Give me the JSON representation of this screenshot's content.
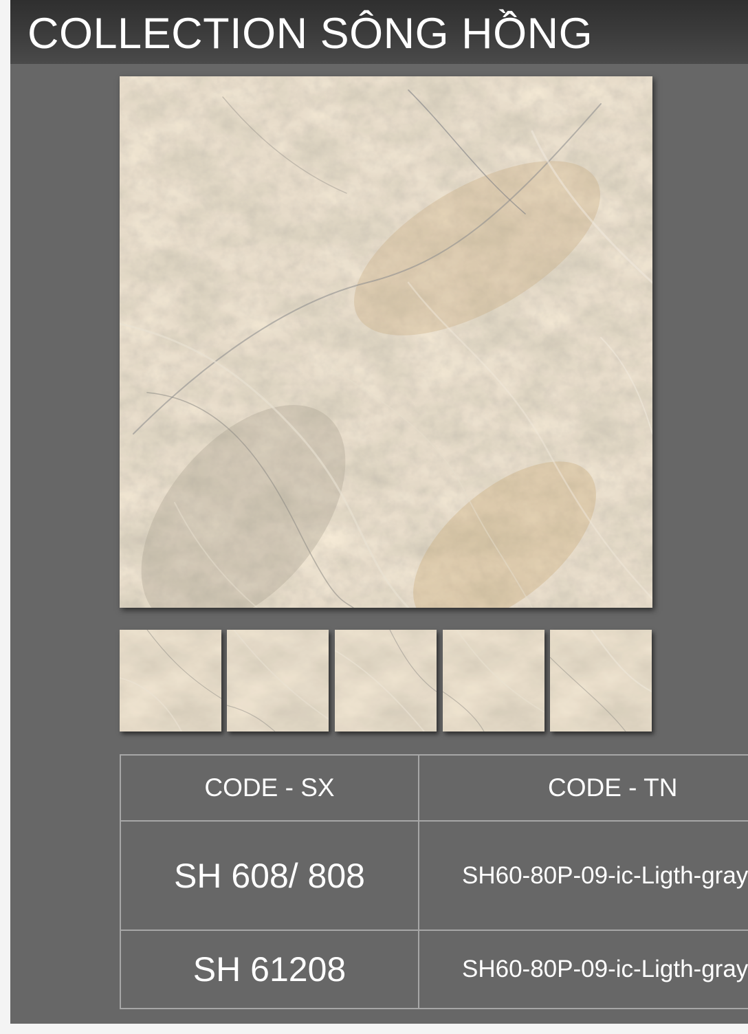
{
  "header": {
    "title": "COLLECTION SÔNG HỒNG"
  },
  "product": {
    "main_image": "marble-tile-image",
    "thumbnails": [
      "marble-tile-thumbnail",
      "marble-tile-thumbnail",
      "marble-tile-thumbnail",
      "marble-tile-thumbnail",
      "marble-tile-thumbnail"
    ]
  },
  "codes_table": {
    "headers": [
      "CODE - SX",
      "CODE - TN"
    ],
    "rows": [
      {
        "sx": "SH 608/ 808",
        "tn": "SH60-80P-09-ic-Ligth-gray"
      },
      {
        "sx": "SH 61208",
        "tn": "SH60-80P-09-ic-Ligth-gray"
      }
    ]
  },
  "colors": {
    "panel_background": "#676767",
    "title_bar": "#3a3a3a",
    "title_text": "#ffffff",
    "table_border": "#a7a7a7",
    "marble_base": "#c4b497"
  }
}
